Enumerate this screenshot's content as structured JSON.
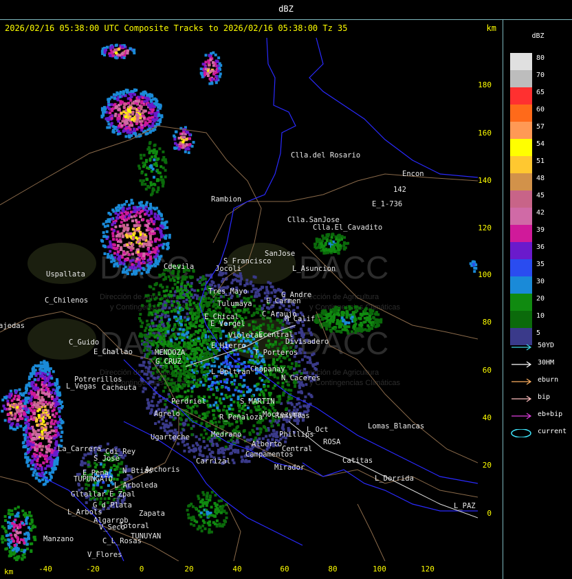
{
  "window_title": "dBZ",
  "header": {
    "text": "2026/02/16 05:38:00 UTC Composite Tracks to 2026/02/16 05:38:00 Tz 35",
    "unit": "km"
  },
  "y_axis": {
    "ticks": [
      "180",
      "160",
      "140",
      "120",
      "100",
      "80",
      "60",
      "40",
      "20",
      "0"
    ]
  },
  "x_axis": {
    "unit": "km",
    "ticks": [
      "-40",
      "-20",
      "0",
      "20",
      "40",
      "60",
      "80",
      "100",
      "120"
    ]
  },
  "legend": {
    "title": "dBZ",
    "scale": [
      {
        "label": "80",
        "color": "#e0e0e0"
      },
      {
        "label": "70",
        "color": "#bdbdbd"
      },
      {
        "label": "65",
        "color": "#ff3030"
      },
      {
        "label": "60",
        "color": "#ff6a1a"
      },
      {
        "label": "57",
        "color": "#ff9955"
      },
      {
        "label": "54",
        "color": "#ffff00"
      },
      {
        "label": "51",
        "color": "#ffc830"
      },
      {
        "label": "48",
        "color": "#d2924a"
      },
      {
        "label": "45",
        "color": "#c86488"
      },
      {
        "label": "42",
        "color": "#d06aa6"
      },
      {
        "label": "39",
        "color": "#d01a9a"
      },
      {
        "label": "36",
        "color": "#6a1acc"
      },
      {
        "label": "35",
        "color": "#2a4cf0"
      },
      {
        "label": "30",
        "color": "#1a8ad8"
      },
      {
        "label": "20",
        "color": "#108a10"
      },
      {
        "label": "10",
        "color": "#0b6a0b"
      },
      {
        "label": "5",
        "color": "#3a3a8a"
      }
    ],
    "tracks": [
      {
        "label": "50YD",
        "color": "#40d8e8"
      },
      {
        "label": "30HM",
        "color": "#ffffff"
      },
      {
        "label": "eburn",
        "color": "#ffb060"
      },
      {
        "label": "bip",
        "color": "#ffc0c0"
      },
      {
        "label": "eb+bip",
        "color": "#e040e0"
      },
      {
        "label": "current",
        "color": "#40e8ff"
      }
    ]
  },
  "watermark": {
    "logo_text": "DACC",
    "line1": "Dirección de Agricultura",
    "line2": "y Contingencias Climáticas"
  },
  "places": [
    {
      "name": "Clla.del Rosario"
    },
    {
      "name": "Encon"
    },
    {
      "name": "142"
    },
    {
      "name": "E_1-736"
    },
    {
      "name": "Rambion"
    },
    {
      "name": "Clla.SanJose"
    },
    {
      "name": "Clla.El_Cavadito"
    },
    {
      "name": "Uspallata"
    },
    {
      "name": "S_Francisco"
    },
    {
      "name": "Jocoli"
    },
    {
      "name": "SanJose"
    },
    {
      "name": "L_Asuncion"
    },
    {
      "name": "Cdevila"
    },
    {
      "name": "C_Chilenos"
    },
    {
      "name": "Tres_Mayo"
    },
    {
      "name": "Tulumaya"
    },
    {
      "name": "E_Carmen"
    },
    {
      "name": "G_Andre"
    },
    {
      "name": "C_Araujo"
    },
    {
      "name": "M_Calif"
    },
    {
      "name": "ajedas"
    },
    {
      "name": "E_Chical"
    },
    {
      "name": "E_Vergel"
    },
    {
      "name": "Ecentral"
    },
    {
      "name": "Divisadero"
    },
    {
      "name": "C_Guido"
    },
    {
      "name": "Violetas"
    },
    {
      "name": "E_Challao"
    },
    {
      "name": "E_Hierro"
    },
    {
      "name": "T_Porteros"
    },
    {
      "name": "MENDOZA"
    },
    {
      "name": "G_CRUZ"
    },
    {
      "name": "L_Beltran"
    },
    {
      "name": "Chapanay"
    },
    {
      "name": "Potrerillos"
    },
    {
      "name": "Cacheuta"
    },
    {
      "name": "L_Vegas"
    },
    {
      "name": "N_Caceres"
    },
    {
      "name": "Perdriel"
    },
    {
      "name": "S_MARTIN"
    },
    {
      "name": "Agrelo"
    },
    {
      "name": "Ugarteche"
    },
    {
      "name": "R_Peñaloza"
    },
    {
      "name": "Moctezuma"
    },
    {
      "name": "Lomas_Blancas"
    },
    {
      "name": "Medrano"
    },
    {
      "name": "Phillips"
    },
    {
      "name": "La_Carrera"
    },
    {
      "name": "Cdi_Rey"
    },
    {
      "name": "S_Jose"
    },
    {
      "name": "Anchoris"
    },
    {
      "name": "Catitas"
    },
    {
      "name": "Carrizal"
    },
    {
      "name": "Campamentos"
    },
    {
      "name": "Mirador"
    },
    {
      "name": "E_Pena"
    },
    {
      "name": "N_Btias"
    },
    {
      "name": "TUPUNGATO"
    },
    {
      "name": "L_Dorrida"
    },
    {
      "name": "L_Arboleda"
    },
    {
      "name": "Gltallar"
    },
    {
      "name": "E_Zpal"
    },
    {
      "name": "L_Arbols"
    },
    {
      "name": "G_d_Plata"
    },
    {
      "name": "Zapata"
    },
    {
      "name": "L_PAZ"
    },
    {
      "name": "Algarrob"
    },
    {
      "name": "V_Seco"
    },
    {
      "name": "Totoral"
    },
    {
      "name": "TUNUYAN"
    },
    {
      "name": "Manzano"
    },
    {
      "name": "C_L_Rosas"
    },
    {
      "name": "V_Flores"
    },
    {
      "name": "Ramillas"
    },
    {
      "name": "L_Oct"
    },
    {
      "name": "ROSA"
    },
    {
      "name": "Central"
    },
    {
      "name": "Alberto"
    }
  ]
}
